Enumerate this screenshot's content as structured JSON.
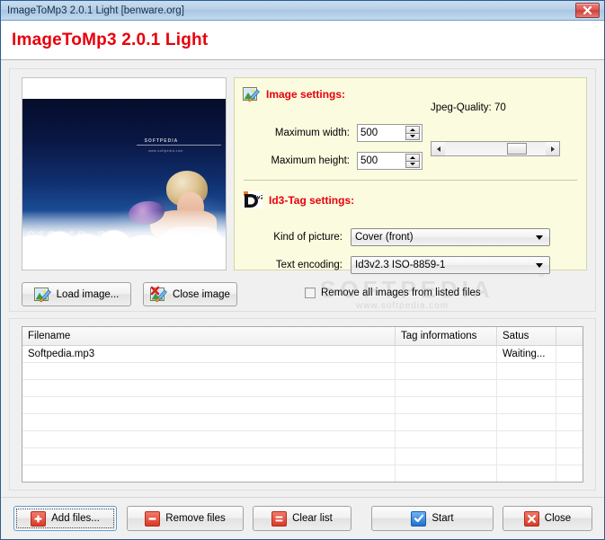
{
  "window": {
    "title": "ImageToMp3 2.0.1 Light [benware.org]",
    "close_icon": "close-x-icon"
  },
  "banner": {
    "title": "ImageToMp3 2.0.1 Light",
    "color": "#e8000a"
  },
  "preview": {
    "watermark_main": "SOFTPEDIA",
    "watermark_sub": "www.softpedia.com",
    "binary_overlay": "010110 01"
  },
  "settings": {
    "image_section": {
      "icon": "image-edit-icon",
      "title": "Image settings:",
      "max_width": {
        "label": "Maximum width:",
        "value": "500"
      },
      "max_height": {
        "label": "Maximum height:",
        "value": "500"
      },
      "jpeg_quality": {
        "label": "Jpeg-Quality: 70",
        "value": 70,
        "min": 0,
        "max": 100
      }
    },
    "id3_section": {
      "icon": "id3-tag-icon",
      "title": "Id3-Tag settings:",
      "kind_of_picture": {
        "label": "Kind of picture:",
        "value": "Cover (front)",
        "options": [
          "Cover (front)"
        ]
      },
      "text_encoding": {
        "label": "Text encoding:",
        "value": "Id3v2.3 ISO-8859-1",
        "options": [
          "Id3v2.3 ISO-8859-1"
        ]
      }
    }
  },
  "image_actions": {
    "load": {
      "label": "Load image...",
      "icon": "picture-pencil-icon"
    },
    "close": {
      "label": "Close image",
      "icon": "picture-delete-icon"
    },
    "remove_all": {
      "label": "Remove all images from listed files",
      "checked": false
    }
  },
  "filelist": {
    "columns": [
      "Filename",
      "Tag informations",
      "Satus",
      ""
    ],
    "rows": [
      {
        "filename": "Softpedia.mp3",
        "tag_info": "",
        "status": "Waiting...",
        "extra": ""
      },
      {
        "filename": "",
        "tag_info": "",
        "status": "",
        "extra": ""
      },
      {
        "filename": "",
        "tag_info": "",
        "status": "",
        "extra": ""
      },
      {
        "filename": "",
        "tag_info": "",
        "status": "",
        "extra": ""
      },
      {
        "filename": "",
        "tag_info": "",
        "status": "",
        "extra": ""
      },
      {
        "filename": "",
        "tag_info": "",
        "status": "",
        "extra": ""
      },
      {
        "filename": "",
        "tag_info": "",
        "status": "",
        "extra": ""
      },
      {
        "filename": "",
        "tag_info": "",
        "status": "",
        "extra": ""
      }
    ]
  },
  "footer": {
    "add_files": {
      "label": "Add files...",
      "icon": "plus-icon"
    },
    "remove_files": {
      "label": "Remove files",
      "icon": "minus-icon"
    },
    "clear_list": {
      "label": "Clear list",
      "icon": "equals-icon"
    },
    "start": {
      "label": "Start",
      "icon": "check-icon"
    },
    "close": {
      "label": "Close",
      "icon": "x-icon"
    }
  },
  "watermark": {
    "main": "SOFTPEDIA",
    "sub": "www.softpedia.com",
    "tm": "™"
  }
}
